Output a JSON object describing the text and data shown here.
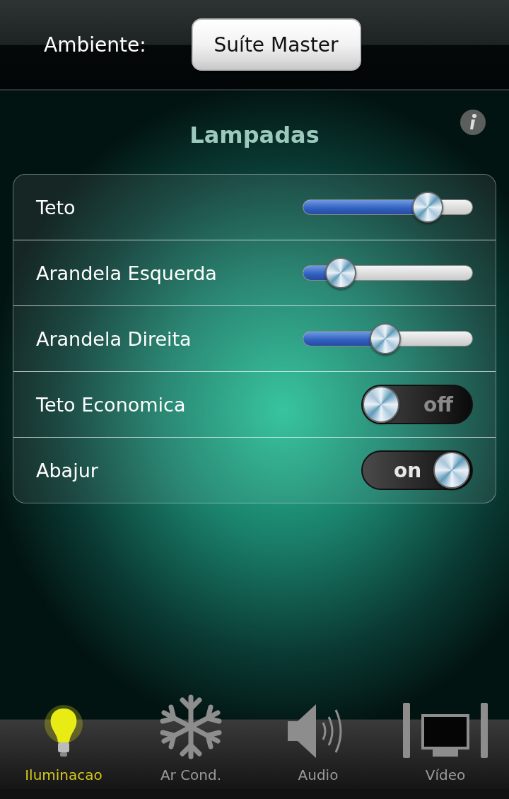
{
  "header": {
    "label": "Ambiente:",
    "room_button": "Suíte Master"
  },
  "section": {
    "title": "Lampadas"
  },
  "controls": [
    {
      "kind": "slider",
      "name": "Teto",
      "level": 0.73
    },
    {
      "kind": "slider",
      "name": "Arandela Esquerda",
      "level": 0.22
    },
    {
      "kind": "slider",
      "name": "Arandela Direita",
      "level": 0.48
    },
    {
      "kind": "toggle",
      "name": "Teto Economica",
      "on": false,
      "label": "off"
    },
    {
      "kind": "toggle",
      "name": "Abajur",
      "on": true,
      "label": "on"
    }
  ],
  "tabs": [
    {
      "kind": "bulb",
      "label": "Iluminacao",
      "selected": true
    },
    {
      "kind": "snowflake",
      "label": "Ar Cond.",
      "selected": false
    },
    {
      "kind": "speaker",
      "label": "Audio",
      "selected": false
    },
    {
      "kind": "tv",
      "label": "Vídeo",
      "selected": false
    }
  ]
}
